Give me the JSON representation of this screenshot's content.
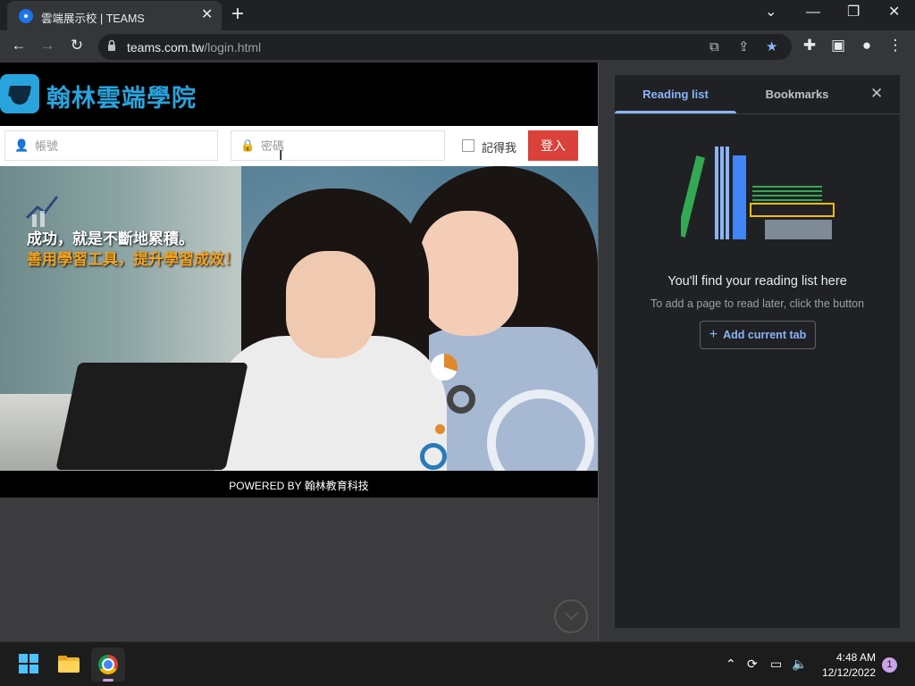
{
  "browser": {
    "tab_title": "雲端展示校 | TEAMS",
    "tab_close": "✕",
    "new_tab": "+",
    "url_host": "teams.com.tw",
    "url_path": "/login.html",
    "window_controls": {
      "minimize": "—",
      "maximize": "❐",
      "close": "✕",
      "tab_search": "⌄"
    }
  },
  "site": {
    "logo_text": "翰林雲端學院",
    "username_placeholder": "帳號",
    "password_placeholder": "密碼",
    "remember_label": "記得我",
    "login_button": "登入",
    "slogan_line1": "成功，就是不斷地累積。",
    "slogan_line2": "善用學習工具，提升學習成效！",
    "footer": "POWERED BY 翰林教育科技",
    "colors": {
      "brand": "#29a3dc",
      "login_button": "#d9413a",
      "slogan_accent": "#f2a422"
    }
  },
  "side_panel": {
    "tabs": [
      {
        "label": "Reading list",
        "active": true
      },
      {
        "label": "Bookmarks",
        "active": false
      }
    ],
    "close_icon": "✕",
    "empty_title": "You'll find your reading list here",
    "empty_subtitle": "To add a page to read later, click the button",
    "add_button_label": "Add current tab",
    "add_button_icon": "+"
  },
  "taskbar": {
    "time": "4:48 AM",
    "date": "12/12/2022",
    "notification_count": "1",
    "apps": [
      "start-menu",
      "file-explorer",
      "chrome"
    ]
  }
}
